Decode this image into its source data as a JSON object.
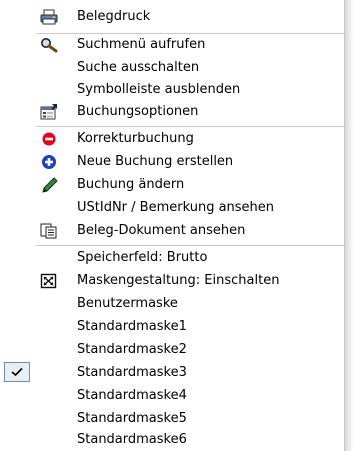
{
  "menu": {
    "items": [
      {
        "label": "Belegdruck",
        "icon": "printer-icon"
      },
      {
        "label": "Suchmenü aufrufen",
        "icon": "search-icon"
      },
      {
        "label": "Suche ausschalten",
        "icon": ""
      },
      {
        "label": "Symbolleiste ausblenden",
        "icon": ""
      },
      {
        "label": "Buchungsoptionen",
        "icon": "options-icon"
      },
      {
        "label": "Korrekturbuchung",
        "icon": "minus-circle-icon"
      },
      {
        "label": "Neue Buchung erstellen",
        "icon": "plus-circle-icon"
      },
      {
        "label": "Buchung ändern",
        "icon": "pen-icon"
      },
      {
        "label": "UStIdNr / Bemerkung ansehen",
        "icon": ""
      },
      {
        "label": "Beleg-Dokument ansehen",
        "icon": "document-icon"
      },
      {
        "label": "Speicherfeld: Brutto",
        "icon": ""
      },
      {
        "label": "Maskengestaltung: Einschalten",
        "icon": "layout-icon"
      },
      {
        "label": "Benutzermaske",
        "icon": ""
      },
      {
        "label": "Standardmaske1",
        "icon": ""
      },
      {
        "label": "Standardmaske2",
        "icon": ""
      },
      {
        "label": "Standardmaske3",
        "icon": "",
        "checked": true
      },
      {
        "label": "Standardmaske4",
        "icon": ""
      },
      {
        "label": "Standardmaske5",
        "icon": ""
      },
      {
        "label": "Standardmaske6",
        "icon": ""
      }
    ]
  },
  "colors": {
    "minus": "#e8001c",
    "plus": "#1d3fc7",
    "pen": "#2f8a3c",
    "check_bg": "#e5eef9",
    "check_border": "#6d8db6"
  }
}
